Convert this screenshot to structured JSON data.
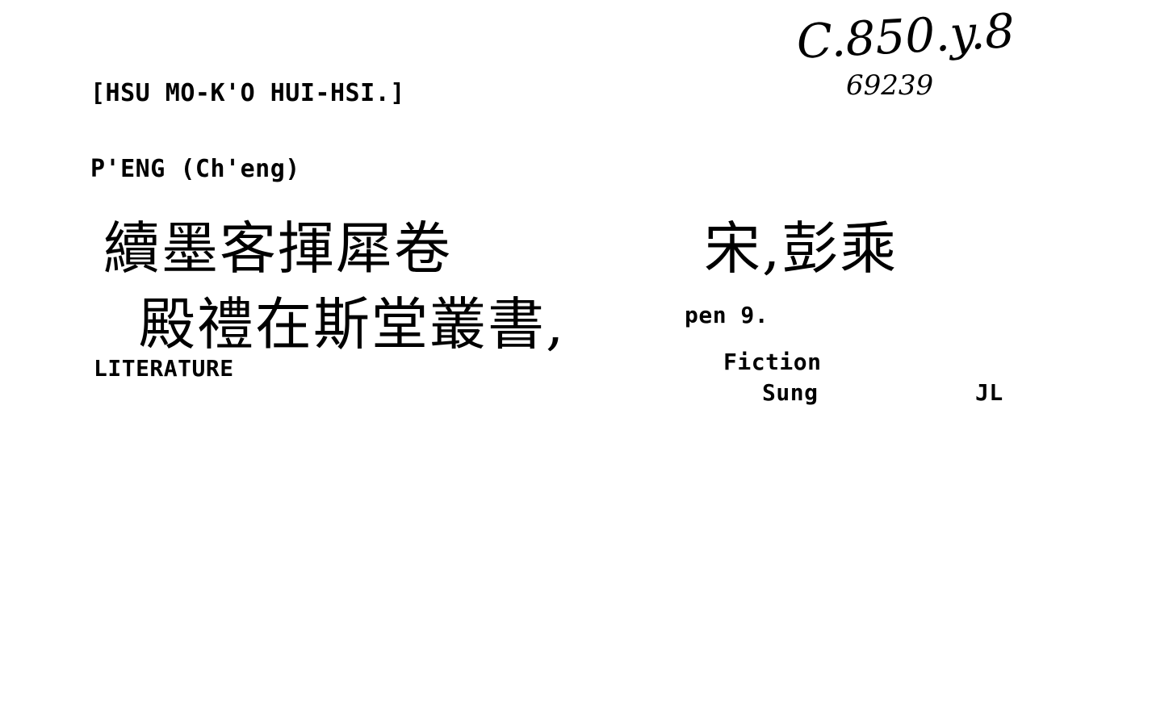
{
  "card": {
    "shelfmark": "C.850.y.8",
    "accession": "69239",
    "title_romanized": "[HSU MO-K'O HUI-HSI.]",
    "author_romanized": "P'ENG (Ch'eng)",
    "title_line_1": "續墨客揮犀卷",
    "author_chinese": "宋,彭乘",
    "title_line_2": "殿禮在斯堂叢書,",
    "volume": "pen 9.",
    "subject": "LITERATURE",
    "subject_sub": "Fiction",
    "period": "Sung",
    "initials": "JL"
  }
}
